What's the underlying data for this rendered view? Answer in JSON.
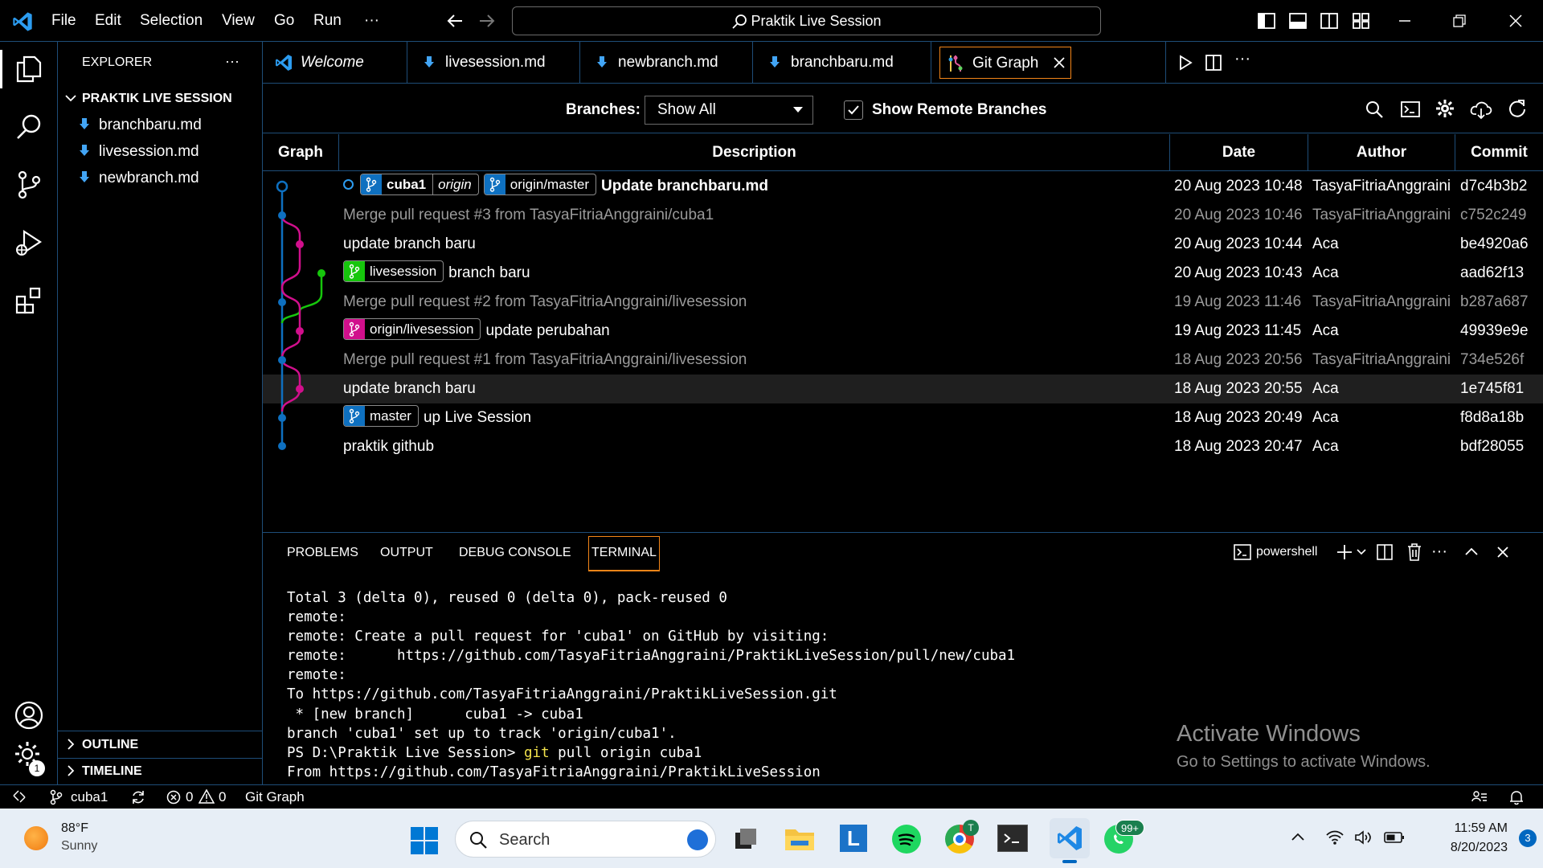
{
  "titlebar": {
    "menus": [
      "File",
      "Edit",
      "Selection",
      "View",
      "Go",
      "Run",
      "···"
    ],
    "command_center": "Praktik Live Session"
  },
  "explorer": {
    "title": "EXPLORER",
    "more": "···",
    "folder": "PRAKTIK LIVE SESSION",
    "files": [
      "branchbaru.md",
      "livesession.md",
      "newbranch.md"
    ],
    "outline": "OUTLINE",
    "timeline": "TIMELINE",
    "settings_badge": "1"
  },
  "tabs": [
    {
      "label": "Welcome",
      "icon": "vscode-logo-icon"
    },
    {
      "label": "livesession.md",
      "icon": "markdown-icon"
    },
    {
      "label": "newbranch.md",
      "icon": "markdown-icon"
    },
    {
      "label": "branchbaru.md",
      "icon": "markdown-icon"
    },
    {
      "label": "Git Graph",
      "icon": "git-graph-icon",
      "active": true
    }
  ],
  "gitgraph": {
    "branches_label": "Branches:",
    "branches_value": "Show All",
    "show_remote_label": "Show Remote Branches",
    "show_remote_checked": true,
    "columns": {
      "graph": "Graph",
      "description": "Description",
      "date": "Date",
      "author": "Author",
      "commit": "Commit"
    },
    "commits": [
      {
        "refs": [
          {
            "name": "cuba1",
            "remote": "origin",
            "color": "#0e70c0",
            "bold": true
          },
          {
            "name": "origin/master",
            "color": "#0e70c0"
          }
        ],
        "message": "Update branchbaru.md",
        "bold": true,
        "date": "20 Aug 2023 10:48",
        "author": "TasyaFitriaAnggraini",
        "hash": "d7c4b3b2",
        "dim": false
      },
      {
        "refs": [],
        "message": "Merge pull request #3 from TasyaFitriaAnggraini/cuba1",
        "date": "20 Aug 2023 10:46",
        "author": "TasyaFitriaAnggraini",
        "hash": "c752c249",
        "dim": true
      },
      {
        "refs": [],
        "message": "update branch baru",
        "date": "20 Aug 2023 10:44",
        "author": "Aca",
        "hash": "be4920a6",
        "dim": false
      },
      {
        "refs": [
          {
            "name": "livesession",
            "color": "#16c60c"
          }
        ],
        "message": "branch baru",
        "date": "20 Aug 2023 10:43",
        "author": "Aca",
        "hash": "aad62f13",
        "dim": false
      },
      {
        "refs": [],
        "message": "Merge pull request #2 from TasyaFitriaAnggraini/livesession",
        "date": "19 Aug 2023 11:46",
        "author": "TasyaFitriaAnggraini",
        "hash": "b287a687",
        "dim": true
      },
      {
        "refs": [
          {
            "name": "origin/livesession",
            "color": "#d10f8c"
          }
        ],
        "message": "update perubahan",
        "date": "19 Aug 2023 11:45",
        "author": "Aca",
        "hash": "49939e9e",
        "dim": false
      },
      {
        "refs": [],
        "message": "Merge pull request #1 from TasyaFitriaAnggraini/livesession",
        "date": "18 Aug 2023 20:56",
        "author": "TasyaFitriaAnggraini",
        "hash": "734e526f",
        "dim": true
      },
      {
        "refs": [],
        "message": "update branch baru",
        "date": "18 Aug 2023 20:55",
        "author": "Aca",
        "hash": "1e745f81",
        "dim": false,
        "hover": true
      },
      {
        "refs": [
          {
            "name": "master",
            "color": "#0e70c0"
          }
        ],
        "message": "up Live Session",
        "date": "18 Aug 2023 20:49",
        "author": "Aca",
        "hash": "f8d8a18b",
        "dim": false
      },
      {
        "refs": [],
        "message": "praktik github",
        "date": "18 Aug 2023 20:47",
        "author": "Aca",
        "hash": "bdf28055",
        "dim": false
      }
    ]
  },
  "panel": {
    "tabs": [
      "PROBLEMS",
      "OUTPUT",
      "DEBUG CONSOLE",
      "TERMINAL"
    ],
    "active_tab": "TERMINAL",
    "shell": "powershell",
    "more": "···",
    "terminal_lines": [
      "Total 3 (delta 0), reused 0 (delta 0), pack-reused 0",
      "remote:",
      "remote: Create a pull request for 'cuba1' on GitHub by visiting:",
      "remote:      https://github.com/TasyaFitriaAnggraini/PraktikLiveSession/pull/new/cuba1",
      "remote:",
      "To https://github.com/TasyaFitriaAnggraini/PraktikLiveSession.git",
      " * [new branch]      cuba1 -> cuba1",
      "branch 'cuba1' set up to track 'origin/cuba1'."
    ],
    "prompt": "PS D:\\Praktik Live Session> ",
    "command_git": "git",
    "command_rest": " pull origin cuba1",
    "last_line": "From https://github.com/TasyaFitriaAnggraini/PraktikLiveSession",
    "watermark_title": "Activate Windows",
    "watermark_sub": "Go to Settings to activate Windows."
  },
  "statusbar": {
    "branch": "cuba1",
    "errors": "0",
    "warnings": "0",
    "view": "Git Graph"
  },
  "taskbar": {
    "weather_temp": "88°F",
    "weather_desc": "Sunny",
    "search_placeholder": "Search",
    "time": "11:59 AM",
    "date": "8/20/2023",
    "notif_count": "3",
    "whatsapp_badge": "99+",
    "chrome_badge": "T"
  },
  "colors": {
    "accent_blue": "#0e70c0",
    "pink": "#d10f8c",
    "green": "#16c60c",
    "border": "#1e4d78",
    "git_green": "#23d18b"
  }
}
